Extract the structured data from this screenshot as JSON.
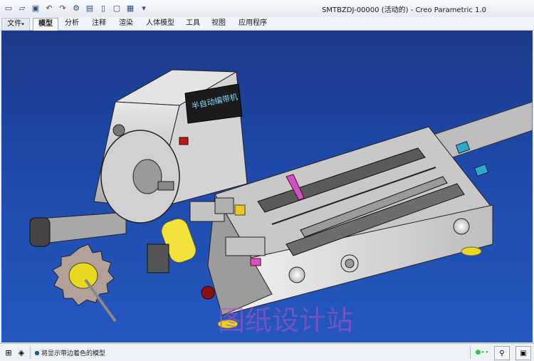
{
  "window": {
    "title": "SMTBZDJ-00000 (活动的) - Creo Parametric 1.0"
  },
  "quick_access": [
    {
      "name": "new-icon",
      "glyph": "▭"
    },
    {
      "name": "open-icon",
      "glyph": "▱"
    },
    {
      "name": "save-icon",
      "glyph": "▣"
    },
    {
      "name": "undo-icon",
      "glyph": "↶"
    },
    {
      "name": "redo-icon",
      "glyph": "↷"
    },
    {
      "name": "regenerate-icon",
      "glyph": "⚙"
    },
    {
      "name": "windows-icon",
      "glyph": "▤"
    },
    {
      "name": "copy-icon",
      "glyph": "▯"
    },
    {
      "name": "page-icon",
      "glyph": "▢"
    },
    {
      "name": "close-window-icon",
      "glyph": "▦"
    },
    {
      "name": "customize-icon",
      "glyph": "▾"
    }
  ],
  "ribbon": {
    "file_label": "文件",
    "tabs": [
      "模型",
      "分析",
      "注释",
      "渲染",
      "人体模型",
      "工具",
      "视图",
      "应用程序"
    ],
    "active_tab": "模型"
  },
  "viewport": {
    "panel_label": "半自动编带机",
    "watermark": "图纸设计站"
  },
  "status": {
    "message": "将显示带边着色的模型",
    "accent_color": "#2cc84a"
  }
}
